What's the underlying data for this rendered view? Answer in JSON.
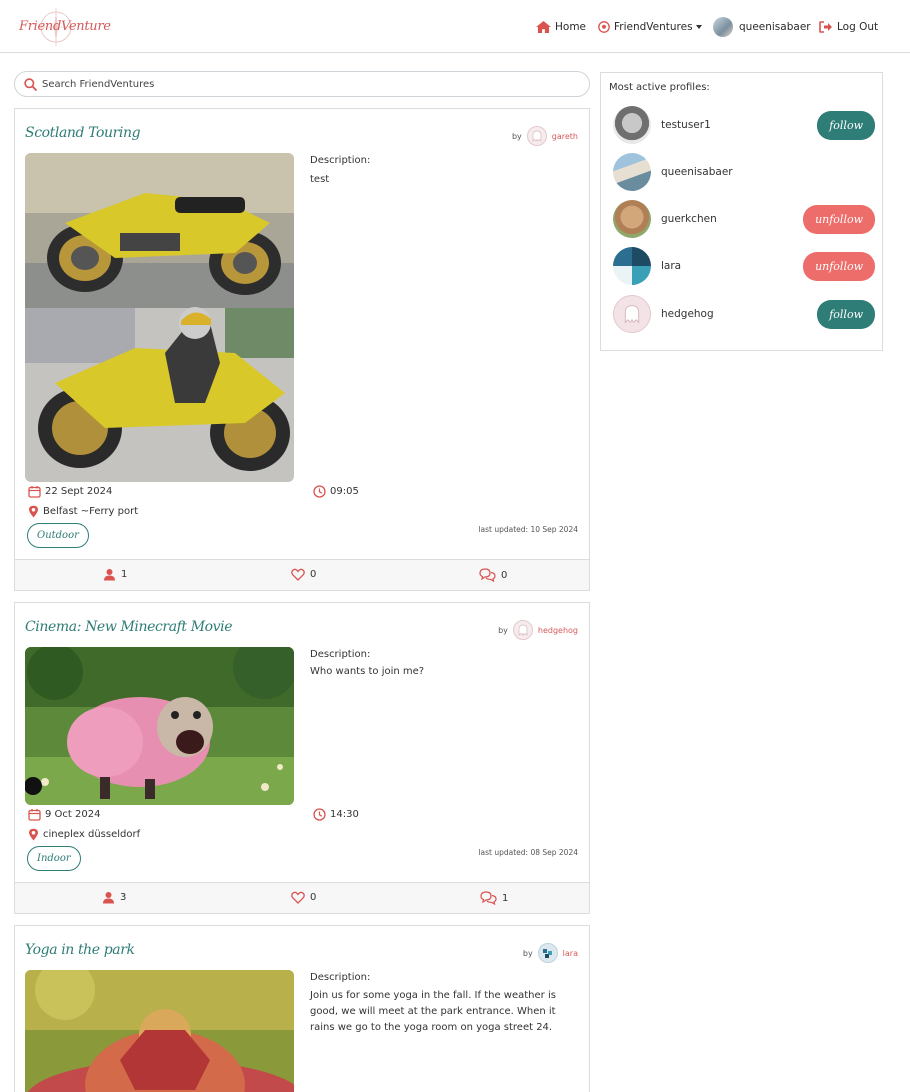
{
  "nav": {
    "logo_text": "FriendVenture",
    "home": "Home",
    "friendventures": "FriendVentures",
    "username": "queenisabaer",
    "logout": "Log Out"
  },
  "search": {
    "placeholder": "Search FriendVentures"
  },
  "posts": [
    {
      "title": "Scotland Touring",
      "by": "by",
      "author": "gareth",
      "description_label": "Description:",
      "description": "test",
      "date": "22 Sept 2024",
      "time": "09:05",
      "location": "Belfast ~Ferry port",
      "updated": "last updated: 10 Sep 2024",
      "tag": "Outdoor",
      "attendees": "1",
      "likes": "0",
      "comments": "0"
    },
    {
      "title": "Cinema: New Minecraft Movie",
      "by": "by",
      "author": "hedgehog",
      "description_label": "Description:",
      "description": "Who wants to join me?",
      "date": "9 Oct 2024",
      "time": "14:30",
      "location": "cineplex düsseldorf",
      "updated": "last updated: 08 Sep 2024",
      "tag": "Indoor",
      "attendees": "3",
      "likes": "0",
      "comments": "1"
    },
    {
      "title": "Yoga in the park",
      "by": "by",
      "author": "lara",
      "description_label": "Description:",
      "description": "Join us for some yoga in the fall. If the weather is good, we will meet at the park entrance. When it rains we go to the yoga room on yoga street 24."
    }
  ],
  "sidebar": {
    "title": "Most active profiles:",
    "profiles": [
      {
        "name": "testuser1",
        "button": "follow"
      },
      {
        "name": "queenisabaer",
        "button": ""
      },
      {
        "name": "guerkchen",
        "button": "unfollow"
      },
      {
        "name": "lara",
        "button": "unfollow"
      },
      {
        "name": "hedgehog",
        "button": "follow"
      }
    ]
  },
  "colors": {
    "accent_teal": "#2e7d77",
    "accent_coral": "#ec6d6a",
    "icon_red": "#d9534f"
  }
}
